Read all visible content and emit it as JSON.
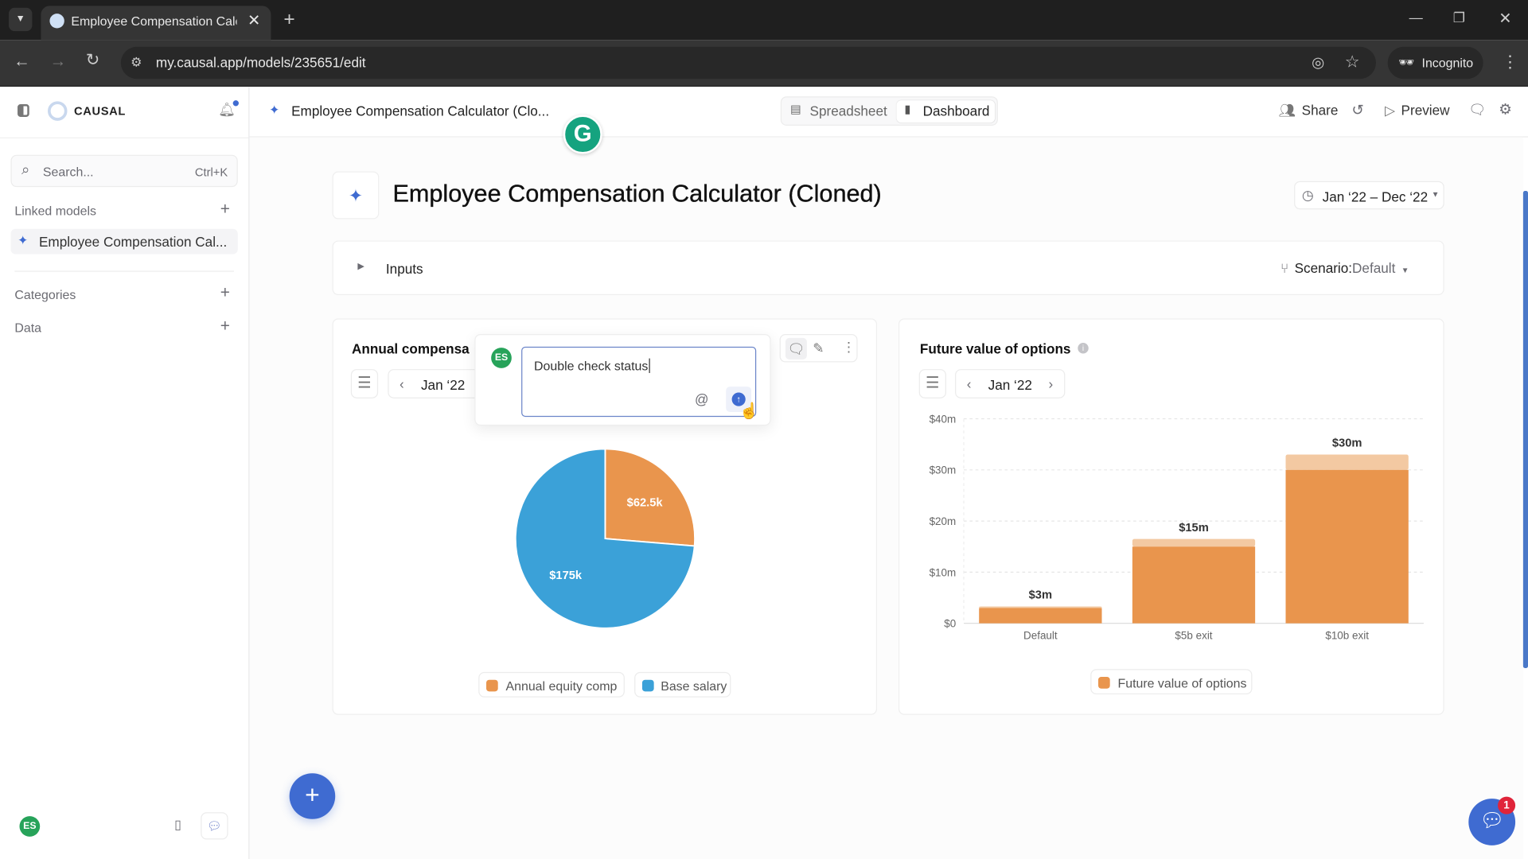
{
  "browser": {
    "tab_title": "Employee Compensation Calcul",
    "url": "my.causal.app/models/235651/edit",
    "profile": "Incognito"
  },
  "sidebar": {
    "brand": "CAUSAL",
    "search_placeholder": "Search...",
    "search_shortcut": "Ctrl+K",
    "sections": [
      {
        "label": "Linked models"
      },
      {
        "label": "Categories"
      },
      {
        "label": "Data"
      }
    ],
    "linked_model": "Employee Compensation Cal...",
    "user_initials": "ES"
  },
  "header": {
    "model_name": "Employee Compensation Calculator (Clo...",
    "views": [
      {
        "label": "Spreadsheet",
        "active": false
      },
      {
        "label": "Dashboard",
        "active": true
      }
    ],
    "share": "Share",
    "preview": "Preview"
  },
  "page": {
    "title": "Employee Compensation Calculator (Cloned)",
    "date_range": "Jan ‘22 – Dec ‘22",
    "inputs_label": "Inputs",
    "scenario_label": "Scenario:",
    "scenario_value": "Default"
  },
  "comment": {
    "initials": "ES",
    "text": "Double check status"
  },
  "fab_label": "+",
  "chat_badge": "1",
  "colors": {
    "orange": "#e9954d",
    "blue": "#3ba1d8",
    "accent": "#3f6bd1",
    "avatar": "#27a35a"
  },
  "chart_data": [
    {
      "type": "pie",
      "title": "Annual compensa",
      "period": "Jan ‘22",
      "slices": [
        {
          "name": "Annual equity comp",
          "value": 62500,
          "label": "$62.5k",
          "color": "#e9954d"
        },
        {
          "name": "Base salary",
          "value": 175000,
          "label": "$175k",
          "color": "#3ba1d8"
        }
      ],
      "legend": "bottom"
    },
    {
      "type": "bar",
      "title": "Future value of options",
      "period": "Jan ‘22",
      "categories": [
        "Default",
        "$5b exit",
        "$10b exit"
      ],
      "series": [
        {
          "name": "Future value of options",
          "values": [
            3,
            15,
            30
          ],
          "labels": [
            "$3m",
            "$15m",
            "$30m"
          ],
          "color": "#e9954d"
        }
      ],
      "ylabel": "",
      "ylim": [
        0,
        40
      ],
      "yticks": [
        "$0",
        "$10m",
        "$20m",
        "$30m",
        "$40m"
      ],
      "grid": true,
      "legend": "bottom"
    }
  ]
}
